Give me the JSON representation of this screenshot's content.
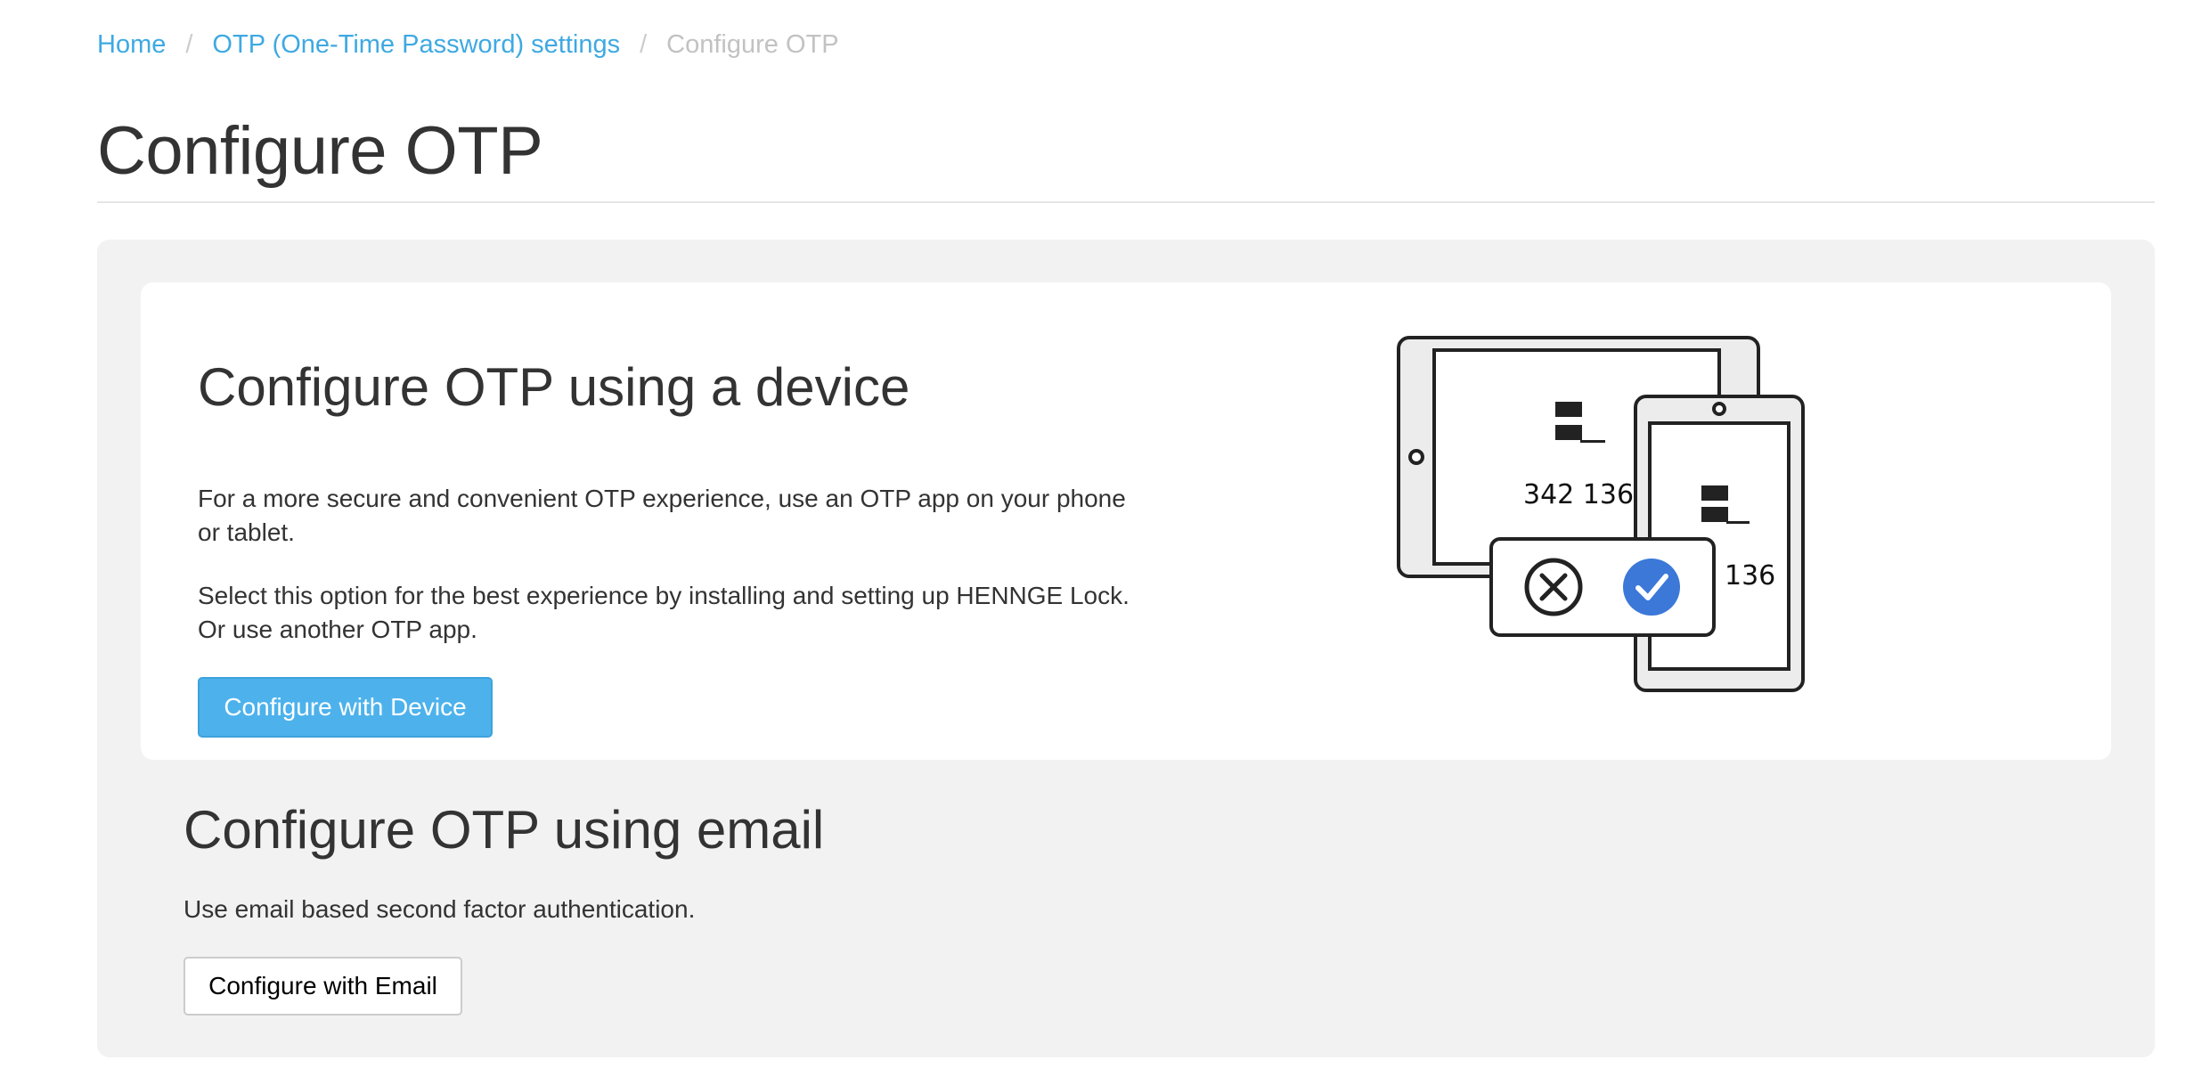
{
  "breadcrumb": {
    "home": "Home",
    "otp_settings": "OTP (One-Time Password) settings",
    "current": "Configure OTP",
    "separator": "/"
  },
  "page_title": "Configure OTP",
  "device_section": {
    "title": "Configure OTP using a device",
    "paragraph1": "For a more secure and convenient OTP experience, use an OTP app on your phone or tablet.",
    "paragraph2": "Select this option for the best experience by installing and setting up HENNGE Lock. Or use another OTP app.",
    "button_label": "Configure with Device",
    "illustration": {
      "tablet_code": "342 136",
      "phone_code": "136",
      "reject_icon": "x-circle-icon",
      "approve_icon": "check-circle-icon",
      "accent_color": "#3b78d8"
    }
  },
  "email_section": {
    "title": "Configure OTP using email",
    "text": "Use email based second factor authentication.",
    "button_label": "Configure with Email"
  },
  "colors": {
    "link": "#3ea9e2",
    "primary_button": "#4db2ec",
    "well_background": "#f2f2f2"
  }
}
